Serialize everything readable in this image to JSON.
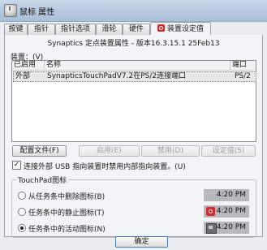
{
  "window": {
    "title": "鼠标 属性"
  },
  "tabs": [
    {
      "label": "按键"
    },
    {
      "label": "指针"
    },
    {
      "label": "指针选项"
    },
    {
      "label": "滑轮"
    },
    {
      "label": "硬件"
    },
    {
      "label": "装置设定值",
      "active": true,
      "icon": "synaptics-logo-icon"
    }
  ],
  "panel": {
    "driver_line": "Synaptics 定点装置属性 - 版本16.3.15.1 25Feb13",
    "devices_label": "装置：(V)",
    "table": {
      "headers": [
        "已启用",
        "名称",
        "端口"
      ],
      "rows": [
        {
          "enabled": "外部",
          "name": "SynapticsTouchPadV7.2在PS/2连接端口",
          "port": "PS/2"
        }
      ]
    },
    "buttons": {
      "configure": "配置文件(F)",
      "enable": "启用(E)",
      "disable": "禁用(D)",
      "settings": "设定值(S)"
    },
    "checkbox": {
      "checked": true,
      "mark": "✓",
      "label": "连接外部 USB 指向装置时禁用内部指向装置。(U)"
    },
    "touchpad_group": {
      "title": "TouchPad图标",
      "options": [
        {
          "label": "从任务条中删除图标(B)",
          "checked": false,
          "tray_time": "4:20 PM",
          "tray_icon": ""
        },
        {
          "label": "任务条中的静止图标(T)",
          "checked": false,
          "tray_time": "4:20 PM",
          "tray_icon": "synaptics-red-icon"
        },
        {
          "label": "任务条中的活动图标(N)",
          "checked": true,
          "tray_time": "4:20 PM",
          "tray_icon": "touchpad-icon"
        }
      ]
    }
  },
  "footer": {
    "ok": "确定"
  },
  "colors": {
    "accent_red": "#d12a2e",
    "titlebar": "#b4c7de",
    "panel_bg": "#f3f4f6"
  }
}
